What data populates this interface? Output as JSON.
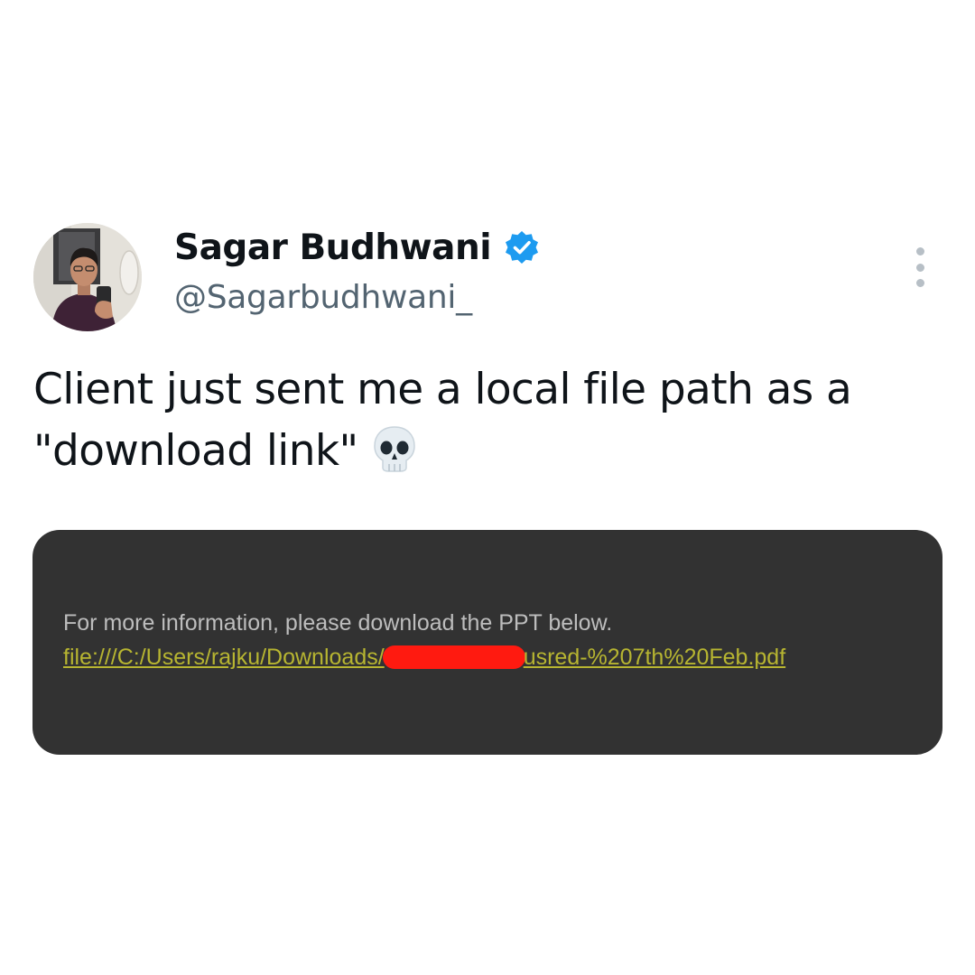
{
  "author": {
    "display_name": "Sagar Budhwani",
    "handle": "@Sagarbudhwani_",
    "verified": true
  },
  "tweet": {
    "text": "Client just sent me a local file path as a \"download link\"",
    "emoji": "skull-icon"
  },
  "media": {
    "line1": "For more information, please download the PPT below.",
    "link_prefix": "file:///C:/Users/rajku/Downloads/",
    "link_suffix": "usred-%207th%20Feb.pdf",
    "redaction_color": "#ff1a10"
  },
  "colors": {
    "verified_blue": "#1d9bf0",
    "name": "#0f1419",
    "handle": "#536471",
    "media_bg": "#323232",
    "link": "#b7b531"
  }
}
